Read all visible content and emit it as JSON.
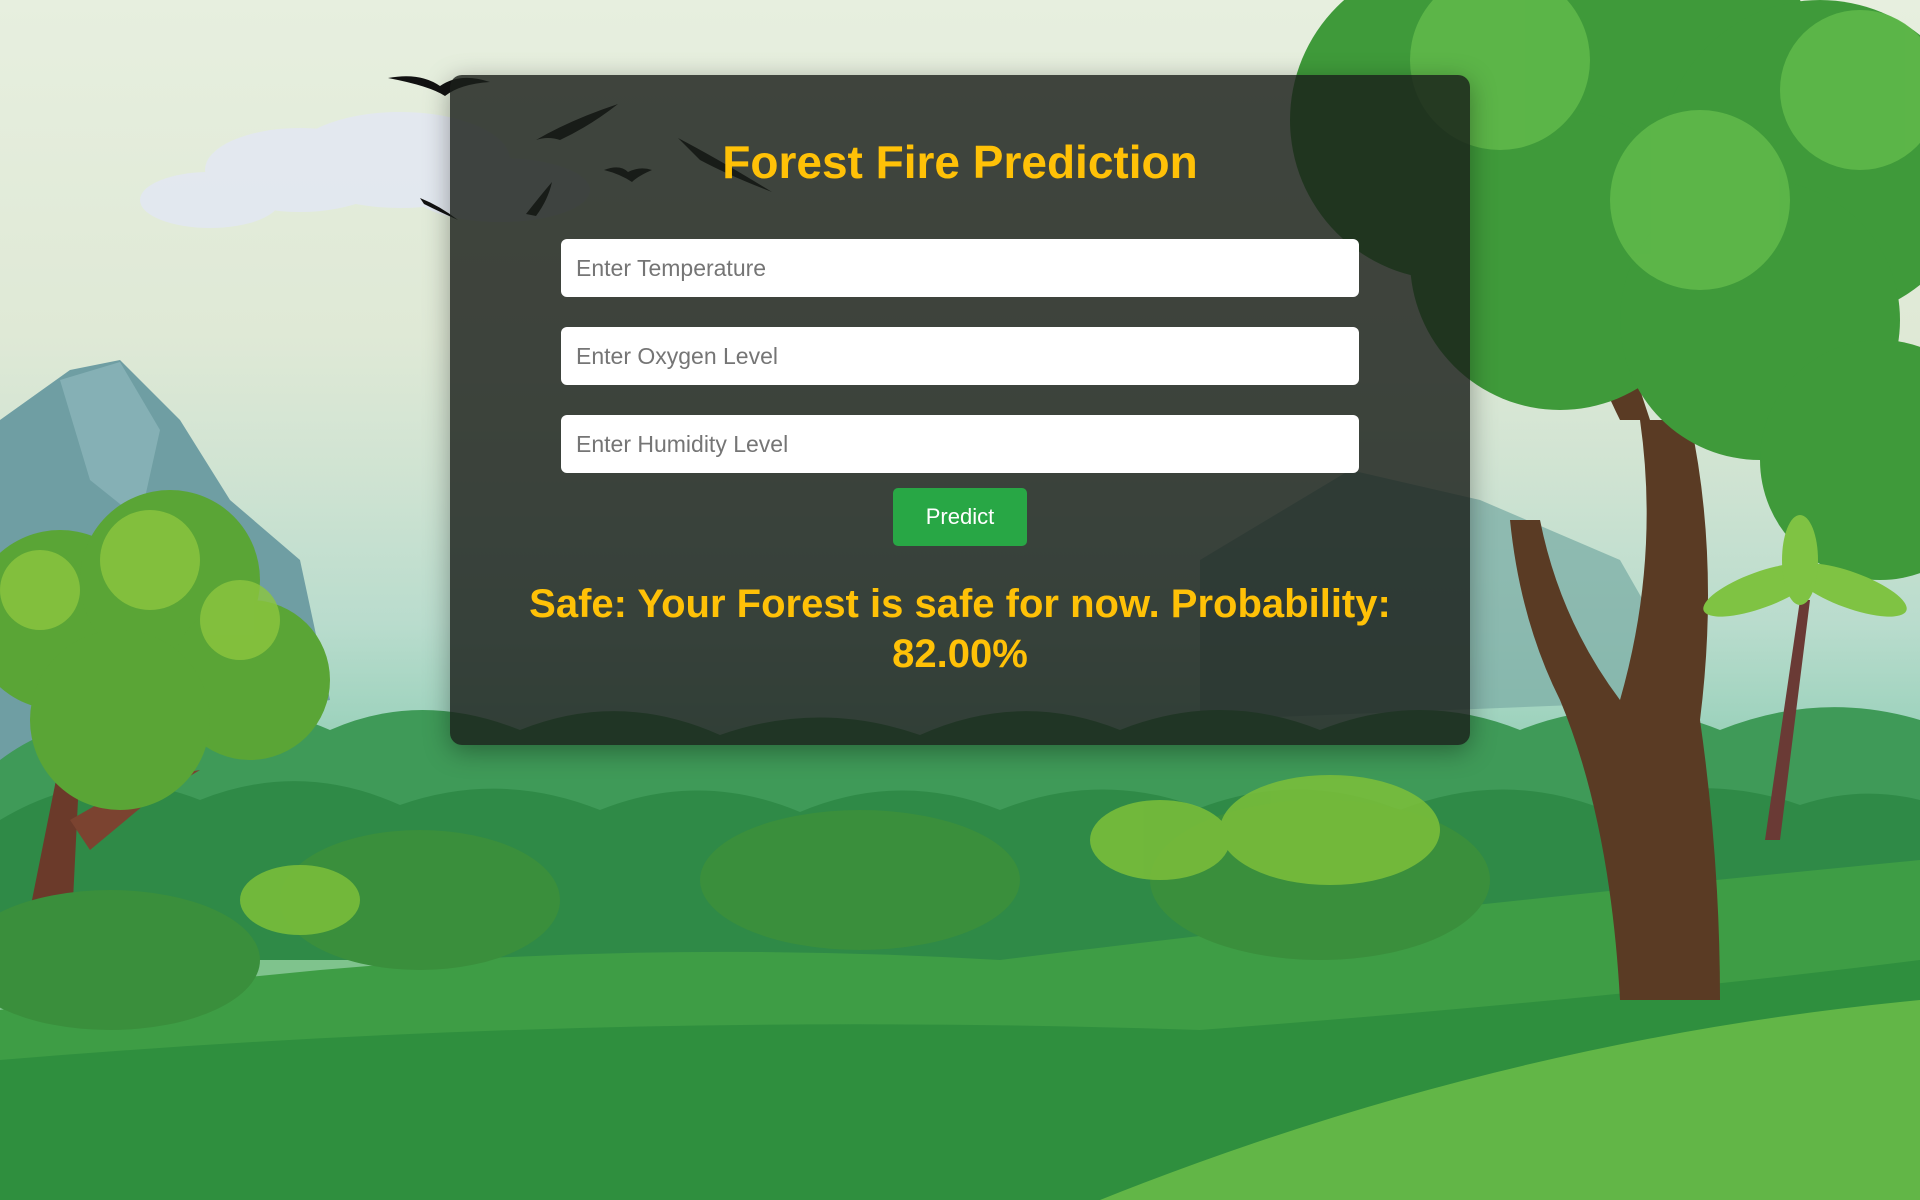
{
  "page": {
    "title": "Forest Fire Prediction"
  },
  "form": {
    "temperature_placeholder": "Enter Temperature",
    "temperature_value": "",
    "oxygen_placeholder": "Enter Oxygen Level",
    "oxygen_value": "",
    "humidity_placeholder": "Enter Humidity Level",
    "humidity_value": "",
    "predict_label": "Predict"
  },
  "result": {
    "text": "Safe: Your Forest is safe for now. Probability: 82.00%"
  },
  "colors": {
    "accent": "#ffc107",
    "button": "#28a745",
    "card_background": "#1a1f1a"
  }
}
